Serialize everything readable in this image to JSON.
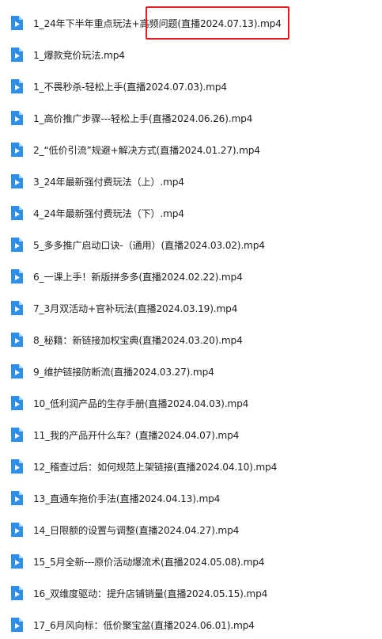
{
  "files": [
    {
      "name": "1_24年下半年重点玩法+高频问题(直播2024.07.13).mp4",
      "icon": "video-file-icon"
    },
    {
      "name": "1_爆款竞价玩法.mp4",
      "icon": "video-file-icon"
    },
    {
      "name": "1_不畏秒杀-轻松上手(直播2024.07.03).mp4",
      "icon": "video-file-icon"
    },
    {
      "name": "1_高价推广步骤---轻松上手(直播2024.06.26).mp4",
      "icon": "video-file-icon"
    },
    {
      "name": "2_“低价引流”规避+解决方式(直播2024.01.27).mp4",
      "icon": "video-file-icon"
    },
    {
      "name": "3_24年最新强付费玩法（上）.mp4",
      "icon": "video-file-icon"
    },
    {
      "name": "4_24年最新强付费玩法（下）.mp4",
      "icon": "video-file-icon"
    },
    {
      "name": "5_多多推广启动口诀-（通用）(直播2024.03.02).mp4",
      "icon": "video-file-icon"
    },
    {
      "name": "6_一课上手！新版拼多多(直播2024.02.22).mp4",
      "icon": "video-file-icon"
    },
    {
      "name": "7_3月双活动+官补玩法(直播2024.03.19).mp4",
      "icon": "video-file-icon"
    },
    {
      "name": "8_秘籍：新链接加权宝典(直播2024.03.20).mp4",
      "icon": "video-file-icon"
    },
    {
      "name": "9_维护链接防断流(直播2024.03.27).mp4",
      "icon": "video-file-icon"
    },
    {
      "name": "10_低利润产品的生存手册(直播2024.04.03).mp4",
      "icon": "video-file-icon"
    },
    {
      "name": "11_我的产品开什么车？(直播2024.04.07).mp4",
      "icon": "video-file-icon"
    },
    {
      "name": "12_稽查过后：如何规范上架链接(直播2024.04.10).mp4",
      "icon": "video-file-icon"
    },
    {
      "name": "13_直通车拖价手法(直播2024.04.13).mp4",
      "icon": "video-file-icon"
    },
    {
      "name": "14_日限额的设置与调整(直播2024.04.27).mp4",
      "icon": "video-file-icon"
    },
    {
      "name": "15_5月全新---原价活动爆流术(直播2024.05.08).mp4",
      "icon": "video-file-icon"
    },
    {
      "name": "16_双维度驱动：提升店铺销量(直播2024.05.15).mp4",
      "icon": "video-file-icon"
    },
    {
      "name": "17_6月风向标：低价聚宝盆(直播2024.06.01).mp4",
      "icon": "video-file-icon"
    }
  ],
  "colors": {
    "icon_blue": "#2e8fe8",
    "icon_page": "#4aa3f0",
    "text": "#1f1f1f",
    "highlight_border": "#e02020"
  }
}
